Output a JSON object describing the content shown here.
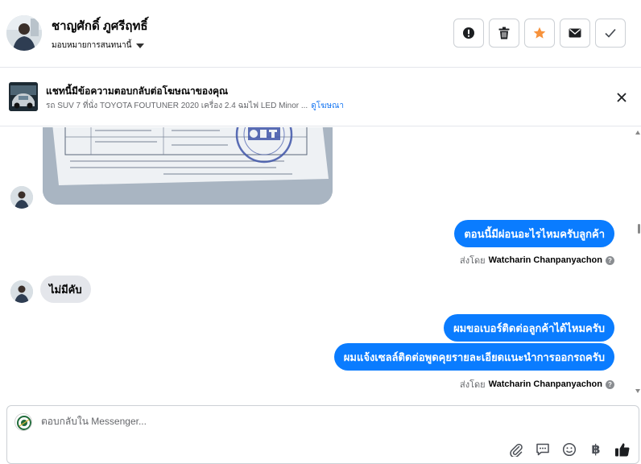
{
  "header": {
    "contact_name": "ชาญศักดิ์ ภูศรีฤทธิ์",
    "assign_label": "มอบหมายการสนทนานี้",
    "actions": [
      {
        "icon": "alert-circle-icon"
      },
      {
        "icon": "trash-icon"
      },
      {
        "icon": "star-icon",
        "color": "#f7923b"
      },
      {
        "icon": "envelope-icon"
      },
      {
        "icon": "checkmark-icon"
      }
    ]
  },
  "ad_banner": {
    "title": "แชทนี้มีข้อความตอบกลับต่อโฆษณาของคุณ",
    "subtitle": "รถ SUV 7 ที่นั่ง TOYOTA FOUTUNER 2020 เครื่อง 2.4 ฉมไฟ LED Minor ...",
    "link_label": "ดูโฆษณา"
  },
  "messages": [
    {
      "direction": "incoming",
      "type": "image"
    },
    {
      "direction": "outgoing",
      "text": "ตอนนี้มีผ่อนอะไรไหมครับลูกค้า"
    },
    {
      "direction": "meta",
      "prefix": "ส่งโดย",
      "sender": "Watcharin Chanpanyachon"
    },
    {
      "direction": "incoming",
      "text": "ไม่มีคับ"
    },
    {
      "direction": "outgoing",
      "text": "ผมขอเบอร์ติดต่อลูกค้าได้ไหมครับ"
    },
    {
      "direction": "outgoing",
      "text": "ผมแจ้งเซลล์ติดต่อพูดคุยรายละเอียดแนะนำการออกรถครับ"
    },
    {
      "direction": "meta",
      "prefix": "ส่งโดย",
      "sender": "Watcharin Chanpanyachon"
    }
  ],
  "composer": {
    "placeholder": "ตอบกลับใน Messenger...",
    "tools": [
      "paperclip-icon",
      "speech-bubble-icon",
      "emoji-icon",
      "baht-icon",
      "thumbs-up-icon"
    ],
    "baht_glyph": "฿"
  },
  "colors": {
    "outgoing_bubble": "#0a7cff",
    "incoming_bubble": "#e4e6eb",
    "link": "#1877f2",
    "star": "#f7923b"
  }
}
